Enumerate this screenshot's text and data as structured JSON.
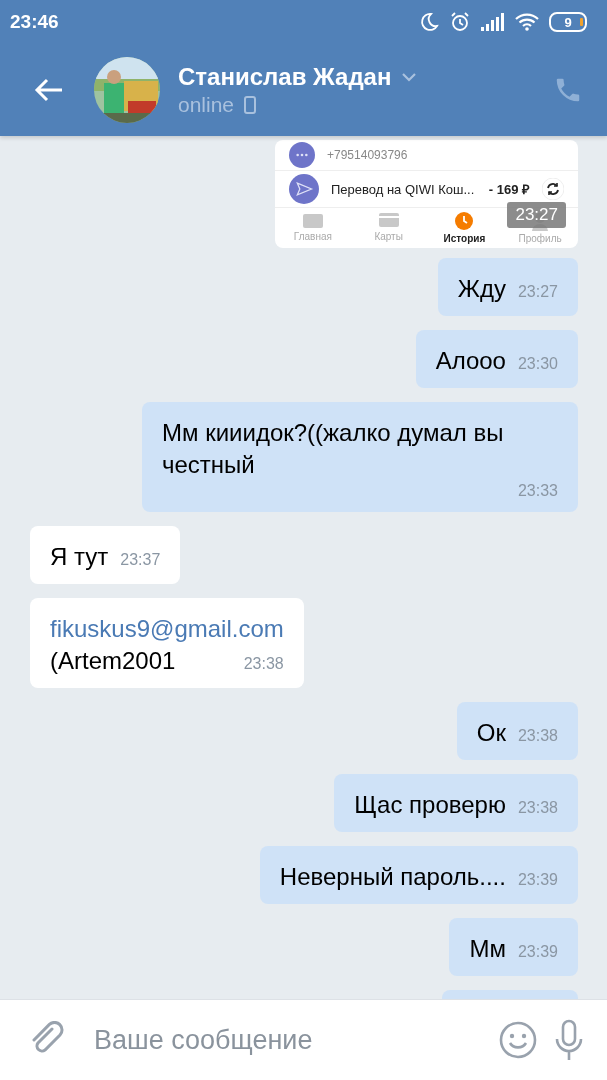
{
  "status_bar": {
    "time": "23:46",
    "battery": "9"
  },
  "header": {
    "name": "Станислав Жадан",
    "status": "online"
  },
  "messages": [
    {
      "kind": "screenshot",
      "outgoing": true,
      "time": "23:27",
      "rows": [
        {
          "subtitle": "+79514093796"
        },
        {
          "title": "Перевод на QIWI Кош...",
          "amount": "- 169 ₽"
        }
      ],
      "tabs": [
        {
          "label": "Главная",
          "selected": false
        },
        {
          "label": "Карты",
          "selected": false
        },
        {
          "label": "История",
          "selected": true
        },
        {
          "label": "Профиль",
          "selected": false
        }
      ]
    },
    {
      "kind": "text",
      "outgoing": true,
      "text": "Жду",
      "time": "23:27"
    },
    {
      "kind": "text",
      "outgoing": true,
      "text": "Алооо",
      "time": "23:30"
    },
    {
      "kind": "text",
      "outgoing": true,
      "text": "Мм кииидок?((жалко думал вы честный",
      "time": "23:33"
    },
    {
      "kind": "text",
      "outgoing": false,
      "text": "Я тут",
      "time": "23:37"
    },
    {
      "kind": "text",
      "outgoing": false,
      "link": "fikuskus9@gmail.com",
      "text": "(Artem2001",
      "time": "23:38"
    },
    {
      "kind": "text",
      "outgoing": true,
      "text": "Ок",
      "time": "23:38"
    },
    {
      "kind": "text",
      "outgoing": true,
      "text": "Щас проверю",
      "time": "23:38"
    },
    {
      "kind": "text",
      "outgoing": true,
      "text": "Неверный пароль....",
      "time": "23:39"
    },
    {
      "kind": "text",
      "outgoing": true,
      "text": "Мм",
      "time": "23:39"
    },
    {
      "kind": "partial",
      "outgoing": true
    }
  ],
  "composer": {
    "placeholder": "Ваше сообщение"
  }
}
